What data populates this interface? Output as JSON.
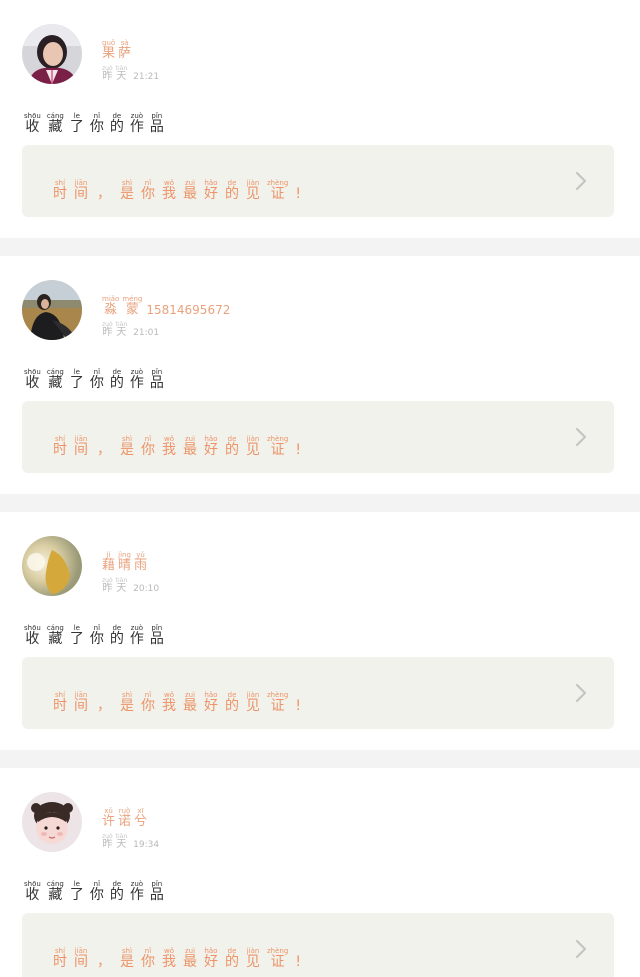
{
  "feed": {
    "items": [
      {
        "user_name": [
          {
            "hz": "果",
            "py": "guǒ"
          },
          {
            "hz": "萨",
            "py": "sà"
          }
        ],
        "user_suffix": "",
        "date_word": [
          {
            "hz": "昨",
            "py": "zuó"
          },
          {
            "hz": "天",
            "py": "tiān"
          }
        ],
        "time": "21:21",
        "action": [
          {
            "hz": "收",
            "py": "shōu"
          },
          {
            "hz": "藏",
            "py": "cáng"
          },
          {
            "hz": "了",
            "py": "le"
          },
          {
            "hz": "你",
            "py": "nǐ"
          },
          {
            "hz": "的",
            "py": "de"
          },
          {
            "hz": "作",
            "py": "zuò"
          },
          {
            "hz": "品",
            "py": "pǐn"
          }
        ],
        "work_title": [
          {
            "hz": "时",
            "py": "shí"
          },
          {
            "hz": "间",
            "py": "jiān"
          },
          {
            "hz": "，",
            "py": ""
          },
          {
            "hz": "是",
            "py": "shì"
          },
          {
            "hz": "你",
            "py": "nǐ"
          },
          {
            "hz": "我",
            "py": "wǒ"
          },
          {
            "hz": "最",
            "py": "zuì"
          },
          {
            "hz": "好",
            "py": "hǎo"
          },
          {
            "hz": "的",
            "py": "de"
          },
          {
            "hz": "见",
            "py": "jiàn"
          },
          {
            "hz": "证",
            "py": "zhèng"
          },
          {
            "hz": "!",
            "py": ""
          }
        ]
      },
      {
        "user_name": [
          {
            "hz": "淼",
            "py": "miǎo"
          },
          {
            "hz": "蒙",
            "py": "méng"
          }
        ],
        "user_suffix": "15814695672",
        "date_word": [
          {
            "hz": "昨",
            "py": "zuó"
          },
          {
            "hz": "天",
            "py": "tiān"
          }
        ],
        "time": "21:01",
        "action": [
          {
            "hz": "收",
            "py": "shōu"
          },
          {
            "hz": "藏",
            "py": "cáng"
          },
          {
            "hz": "了",
            "py": "le"
          },
          {
            "hz": "你",
            "py": "nǐ"
          },
          {
            "hz": "的",
            "py": "de"
          },
          {
            "hz": "作",
            "py": "zuò"
          },
          {
            "hz": "品",
            "py": "pǐn"
          }
        ],
        "work_title": [
          {
            "hz": "时",
            "py": "shí"
          },
          {
            "hz": "间",
            "py": "jiān"
          },
          {
            "hz": "，",
            "py": ""
          },
          {
            "hz": "是",
            "py": "shì"
          },
          {
            "hz": "你",
            "py": "nǐ"
          },
          {
            "hz": "我",
            "py": "wǒ"
          },
          {
            "hz": "最",
            "py": "zuì"
          },
          {
            "hz": "好",
            "py": "hǎo"
          },
          {
            "hz": "的",
            "py": "de"
          },
          {
            "hz": "见",
            "py": "jiàn"
          },
          {
            "hz": "证",
            "py": "zhèng"
          },
          {
            "hz": "!",
            "py": ""
          }
        ]
      },
      {
        "user_name": [
          {
            "hz": "藉",
            "py": "jí"
          },
          {
            "hz": "晴",
            "py": "jìng"
          },
          {
            "hz": "雨",
            "py": "yǔ"
          }
        ],
        "user_suffix": "",
        "date_word": [
          {
            "hz": "昨",
            "py": "zuó"
          },
          {
            "hz": "天",
            "py": "tiān"
          }
        ],
        "time": "20:10",
        "action": [
          {
            "hz": "收",
            "py": "shōu"
          },
          {
            "hz": "藏",
            "py": "cáng"
          },
          {
            "hz": "了",
            "py": "le"
          },
          {
            "hz": "你",
            "py": "nǐ"
          },
          {
            "hz": "的",
            "py": "de"
          },
          {
            "hz": "作",
            "py": "zuò"
          },
          {
            "hz": "品",
            "py": "pǐn"
          }
        ],
        "work_title": [
          {
            "hz": "时",
            "py": "shí"
          },
          {
            "hz": "间",
            "py": "jiān"
          },
          {
            "hz": "，",
            "py": ""
          },
          {
            "hz": "是",
            "py": "shì"
          },
          {
            "hz": "你",
            "py": "nǐ"
          },
          {
            "hz": "我",
            "py": "wǒ"
          },
          {
            "hz": "最",
            "py": "zuì"
          },
          {
            "hz": "好",
            "py": "hǎo"
          },
          {
            "hz": "的",
            "py": "de"
          },
          {
            "hz": "见",
            "py": "jiàn"
          },
          {
            "hz": "证",
            "py": "zhèng"
          },
          {
            "hz": "!",
            "py": ""
          }
        ]
      },
      {
        "user_name": [
          {
            "hz": "许",
            "py": "xǔ"
          },
          {
            "hz": "诺",
            "py": "ruò"
          },
          {
            "hz": "兮",
            "py": "xī"
          }
        ],
        "user_suffix": "",
        "date_word": [
          {
            "hz": "昨",
            "py": "zuó"
          },
          {
            "hz": "天",
            "py": "tiān"
          }
        ],
        "time": "19:34",
        "action": [
          {
            "hz": "收",
            "py": "shōu"
          },
          {
            "hz": "藏",
            "py": "cáng"
          },
          {
            "hz": "了",
            "py": "le"
          },
          {
            "hz": "你",
            "py": "nǐ"
          },
          {
            "hz": "的",
            "py": "de"
          },
          {
            "hz": "作",
            "py": "zuò"
          },
          {
            "hz": "品",
            "py": "pǐn"
          }
        ],
        "work_title": [
          {
            "hz": "时",
            "py": "shí"
          },
          {
            "hz": "间",
            "py": "jiān"
          },
          {
            "hz": "，",
            "py": ""
          },
          {
            "hz": "是",
            "py": "shì"
          },
          {
            "hz": "你",
            "py": "nǐ"
          },
          {
            "hz": "我",
            "py": "wǒ"
          },
          {
            "hz": "最",
            "py": "zuì"
          },
          {
            "hz": "好",
            "py": "hǎo"
          },
          {
            "hz": "的",
            "py": "de"
          },
          {
            "hz": "见",
            "py": "jiàn"
          },
          {
            "hz": "证",
            "py": "zhèng"
          },
          {
            "hz": "!",
            "py": ""
          }
        ]
      }
    ]
  },
  "icons": {
    "chevron": "chevron-right-icon",
    "avatars": [
      "avatar-woman-portrait",
      "avatar-woman-field",
      "avatar-blurred-light",
      "avatar-child"
    ]
  },
  "colors": {
    "username": "#e9a27d",
    "timestamp": "#b9b9b9",
    "action_text": "#333333",
    "work_title": "#ec9468",
    "work_card_bg": "#f2f2ec",
    "page_bg": "#f3f3f3"
  }
}
